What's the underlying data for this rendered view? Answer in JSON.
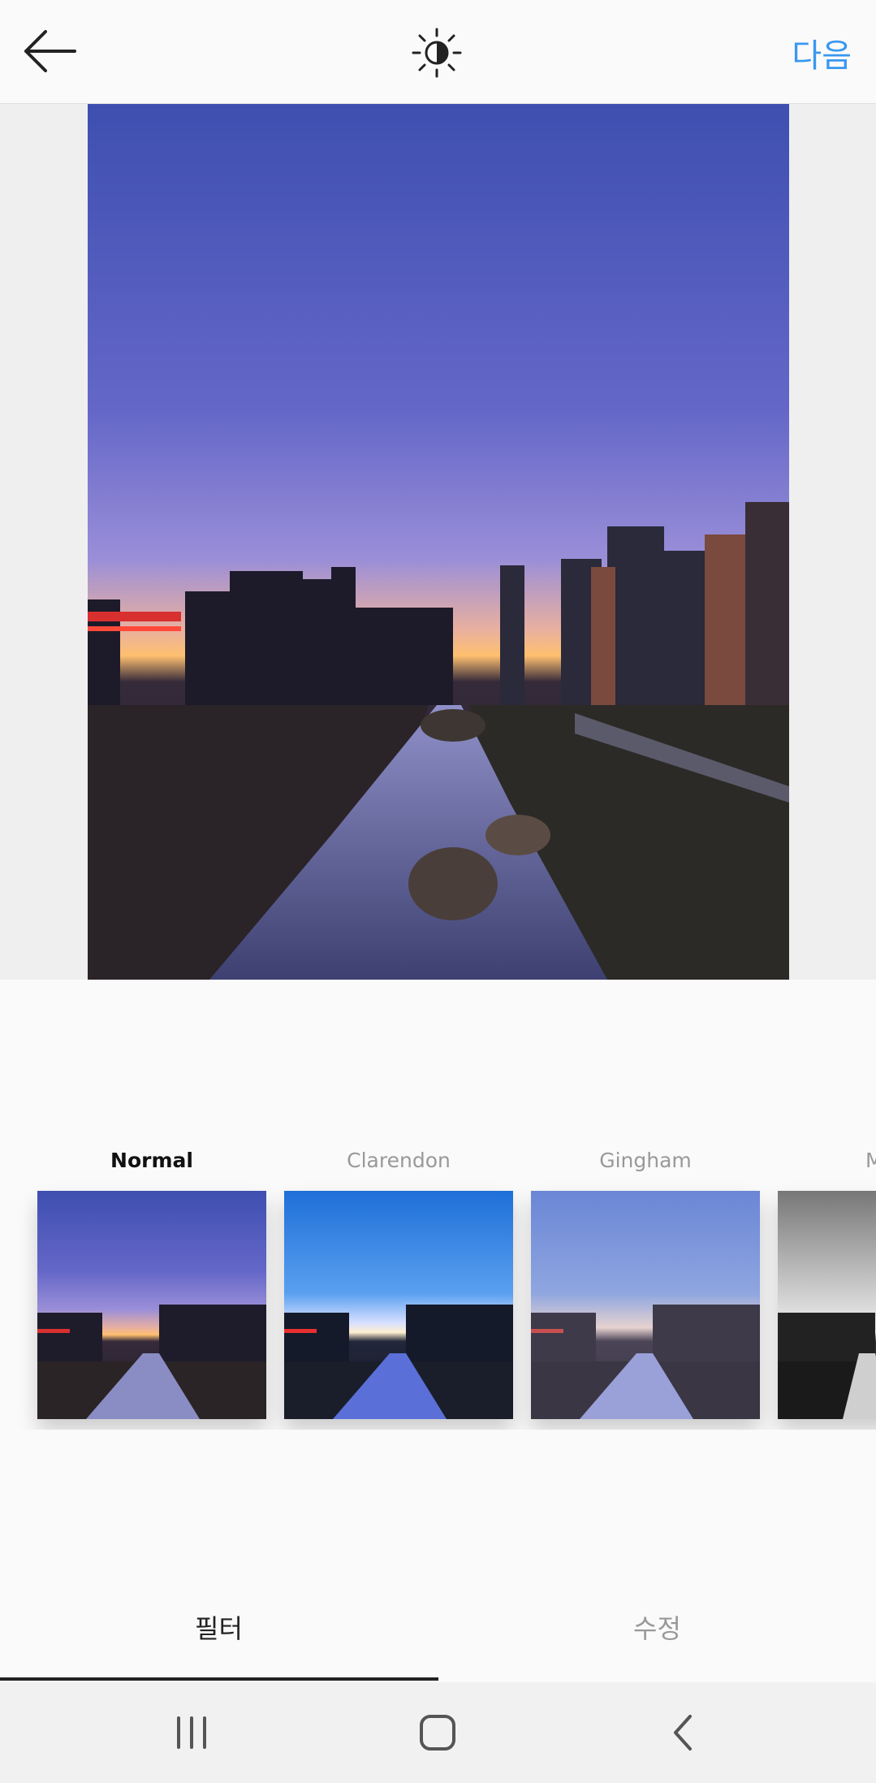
{
  "topbar": {
    "back_icon": "arrow-left-icon",
    "lux_icon": "brightness-icon",
    "next_label": "다음"
  },
  "filters": [
    {
      "name": "Normal",
      "active": true
    },
    {
      "name": "Clarendon",
      "active": false
    },
    {
      "name": "Gingham",
      "active": false
    },
    {
      "name": "M",
      "active": false
    }
  ],
  "tabs": [
    {
      "label": "필터",
      "active": true
    },
    {
      "label": "수정",
      "active": false
    }
  ],
  "navbar": {
    "recents_icon": "recent-apps-icon",
    "home_icon": "home-icon",
    "back_icon": "back-chevron-icon"
  },
  "colors": {
    "accent": "#3897f0",
    "sky_top": "#3f51b5",
    "sky_horizon": "#f4a460"
  }
}
